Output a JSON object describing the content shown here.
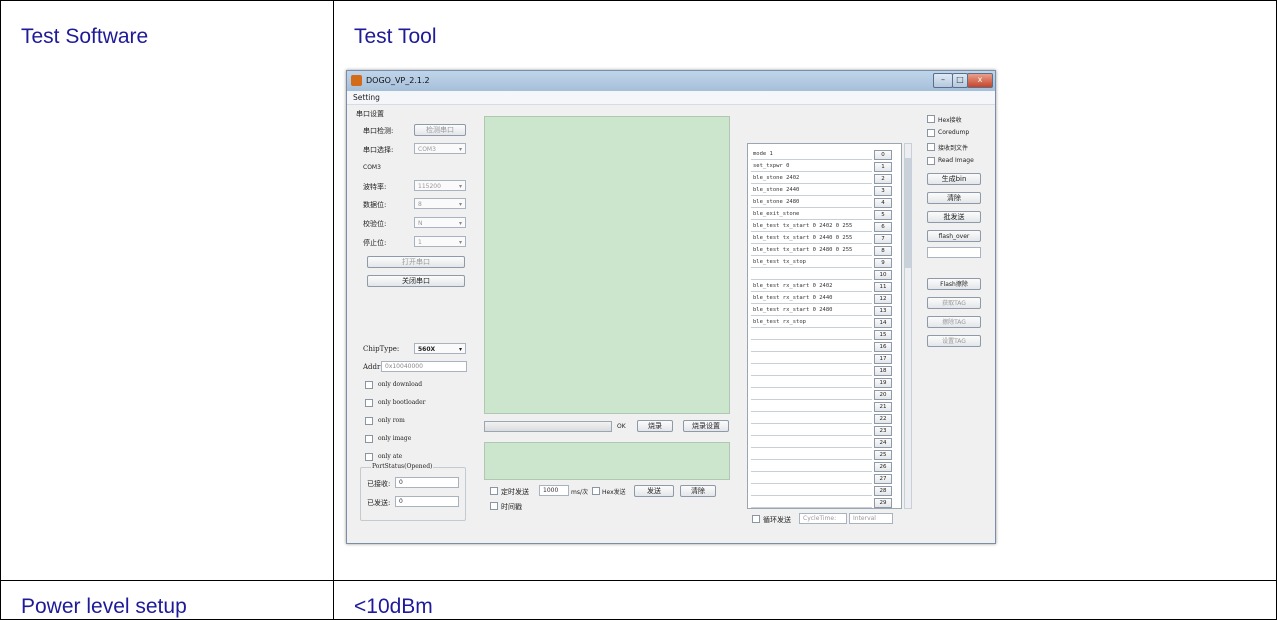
{
  "table": {
    "row1_label": "Test Software",
    "row1_value": "Test Tool",
    "row2_label": "Power level setup",
    "row2_value": "<10dBm"
  },
  "window": {
    "title": "DOGO_VP_2.1.2",
    "menu": "Setting",
    "min_btn": "–",
    "max_btn": "□",
    "close_btn": "x"
  },
  "serial": {
    "group_title": "串口设置",
    "detect_label": "串口检测:",
    "detect_btn": "检测串口",
    "select_label": "串口选择:",
    "select_value": "COM3",
    "com_label": "COM3",
    "baud_label": "波特率:",
    "baud_value": "115200",
    "data_label": "数据位:",
    "data_value": "8",
    "parity_label": "校验位:",
    "parity_value": "N",
    "stop_label": "停止位:",
    "stop_value": "1",
    "open_btn": "打开串口",
    "close_btn": "关闭串口"
  },
  "chip": {
    "type_label": "ChipType:",
    "type_value": "560X",
    "addr_label": "Addr",
    "addr_value": "0x10040000",
    "opts": [
      "only download",
      "only bootloader",
      "only rom",
      "only image",
      "only ate"
    ],
    "port_status": "PortStatus(Opened)",
    "recv_label": "已接收:",
    "recv_value": "0",
    "sent_label": "已发送:",
    "sent_value": "0"
  },
  "center": {
    "ok_label": "OK",
    "burn_btn": "烧录",
    "burn_settings_btn": "烧录设置",
    "timed_send_label": "定时发送",
    "interval_value": "1000",
    "unit_label": "ms/次",
    "hex_send_label": "Hex发送",
    "send_btn": "发送",
    "clear_btn": "清除",
    "timestamp_label": "时间戳"
  },
  "commands": [
    {
      "text": "mode 1",
      "num": "0"
    },
    {
      "text": "set_txpwr 0",
      "num": "1"
    },
    {
      "text": "ble_stone 2402",
      "num": "2"
    },
    {
      "text": "ble_stone 2440",
      "num": "3"
    },
    {
      "text": "ble_stone 2480",
      "num": "4"
    },
    {
      "text": "ble_exit_stone",
      "num": "5"
    },
    {
      "text": "ble_test tx_start 0 2402 0 255",
      "num": "6"
    },
    {
      "text": "ble_test tx_start 0 2440 0 255",
      "num": "7"
    },
    {
      "text": "ble_test tx_start 0 2480 0 255",
      "num": "8"
    },
    {
      "text": "ble_test tx_stop",
      "num": "9"
    },
    {
      "text": "",
      "num": "10"
    },
    {
      "text": "ble_test rx_start 0 2402",
      "num": "11"
    },
    {
      "text": "ble_test rx_start 0 2440",
      "num": "12"
    },
    {
      "text": "ble_test rx_start 0 2480",
      "num": "13"
    },
    {
      "text": "ble_test rx_stop",
      "num": "14"
    },
    {
      "text": "",
      "num": "15"
    },
    {
      "text": "",
      "num": "16"
    },
    {
      "text": "",
      "num": "17"
    },
    {
      "text": "",
      "num": "18"
    },
    {
      "text": "",
      "num": "19"
    },
    {
      "text": "",
      "num": "20"
    },
    {
      "text": "",
      "num": "21"
    },
    {
      "text": "",
      "num": "22"
    },
    {
      "text": "",
      "num": "23"
    },
    {
      "text": "",
      "num": "24"
    },
    {
      "text": "",
      "num": "25"
    },
    {
      "text": "",
      "num": "26"
    },
    {
      "text": "",
      "num": "27"
    },
    {
      "text": "",
      "num": "28"
    },
    {
      "text": "",
      "num": "29"
    }
  ],
  "bottom": {
    "cycle_send_label": "循环发送",
    "cycle_time_placeholder": "CycleTime:",
    "interval_placeholder": "Interval"
  },
  "right": {
    "hex_recv": "Hex接收",
    "coredump": "Coredump",
    "recv_to_file": "接收到文件",
    "read_image": "Read Image",
    "gen_bin": "生成bin",
    "clear": "清除",
    "batch_send": "批发送",
    "flash_over": "flash_over",
    "flash_erase": "Flash擦除",
    "get_tag": "获取TAG",
    "erase_tag": "擦除TAG",
    "set_tag": "设置TAG"
  }
}
